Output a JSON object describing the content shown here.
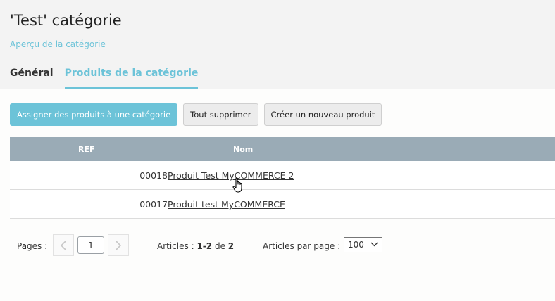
{
  "header": {
    "title": "'Test' catégorie",
    "preview_link": "Aperçu de la catégorie",
    "tabs": [
      {
        "label": "Général",
        "active": false
      },
      {
        "label": "Produits de la catégorie",
        "active": true
      }
    ]
  },
  "toolbar": {
    "assign_label": "Assigner des produits à une catégorie",
    "delete_all_label": "Tout supprimer",
    "new_product_label": "Créer un nouveau produit"
  },
  "table": {
    "columns": {
      "ref": "REF",
      "nom": "Nom"
    },
    "rows": [
      {
        "ref": "00018",
        "nom": "Produit Test MyCOMMERCE 2"
      },
      {
        "ref": "00017",
        "nom": "Produit test MyCOMMERCE"
      }
    ]
  },
  "pagination": {
    "pages_label": "Pages :",
    "current_page": "1",
    "prev_icon": "chevron-left-icon",
    "next_icon": "chevron-right-icon",
    "articles_label": "Articles :",
    "articles_range": "1-2",
    "articles_of": "de",
    "articles_total": "2",
    "per_page_label": "Articles par page :",
    "per_page_value": "100"
  },
  "colors": {
    "accent": "#6cc3d8",
    "table_header": "#9aabb6"
  }
}
